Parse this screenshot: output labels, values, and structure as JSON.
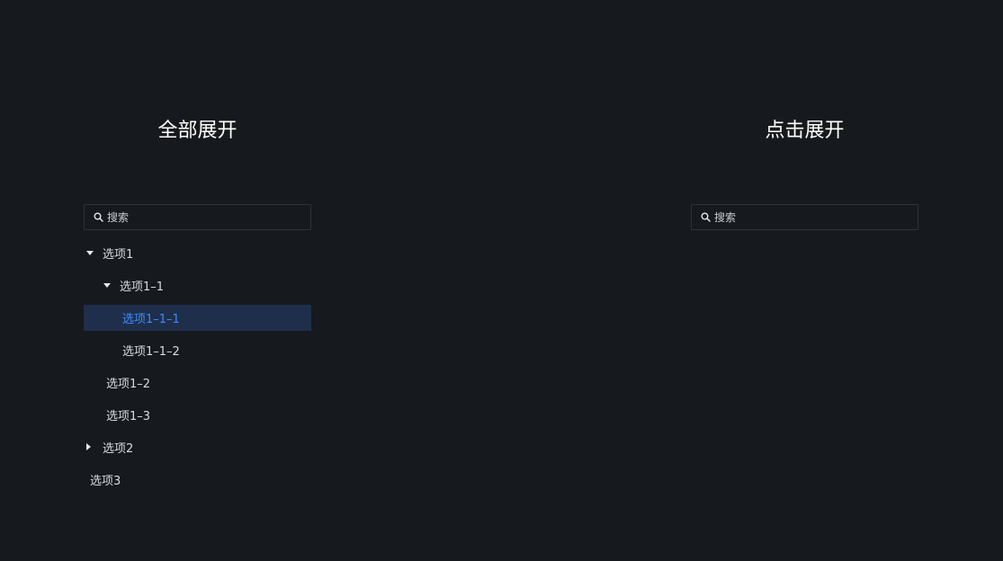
{
  "panels": [
    {
      "title": "全部展开",
      "search": {
        "placeholder": "搜索"
      },
      "tree": [
        {
          "label": "选项1",
          "level": 0,
          "caret": "down"
        },
        {
          "label": "选项1–1",
          "level": 1,
          "caret": "down"
        },
        {
          "label": "选项1–1–1",
          "level": 2,
          "caret": "none",
          "selected": true
        },
        {
          "label": "选项1–1–2",
          "level": 2,
          "caret": "none"
        },
        {
          "label": "选项1–2",
          "level": 1,
          "caret": "none"
        },
        {
          "label": "选项1–3",
          "level": 1,
          "caret": "none"
        },
        {
          "label": "选项2",
          "level": 0,
          "caret": "right"
        },
        {
          "label": "选项3",
          "level": 0,
          "caret": "none",
          "leaf_root": true
        }
      ]
    },
    {
      "title": "点击展开",
      "search": {
        "placeholder": "搜索"
      },
      "tree": []
    }
  ],
  "colors": {
    "background": "#16191e",
    "selected_bg": "#1f2f4b",
    "selected_text": "#3d8bff",
    "text": "#d8dbe0",
    "border": "#2e333b"
  },
  "icons": {
    "search": "search-icon",
    "expanded": "caret-down-icon",
    "collapsed": "caret-right-icon"
  }
}
